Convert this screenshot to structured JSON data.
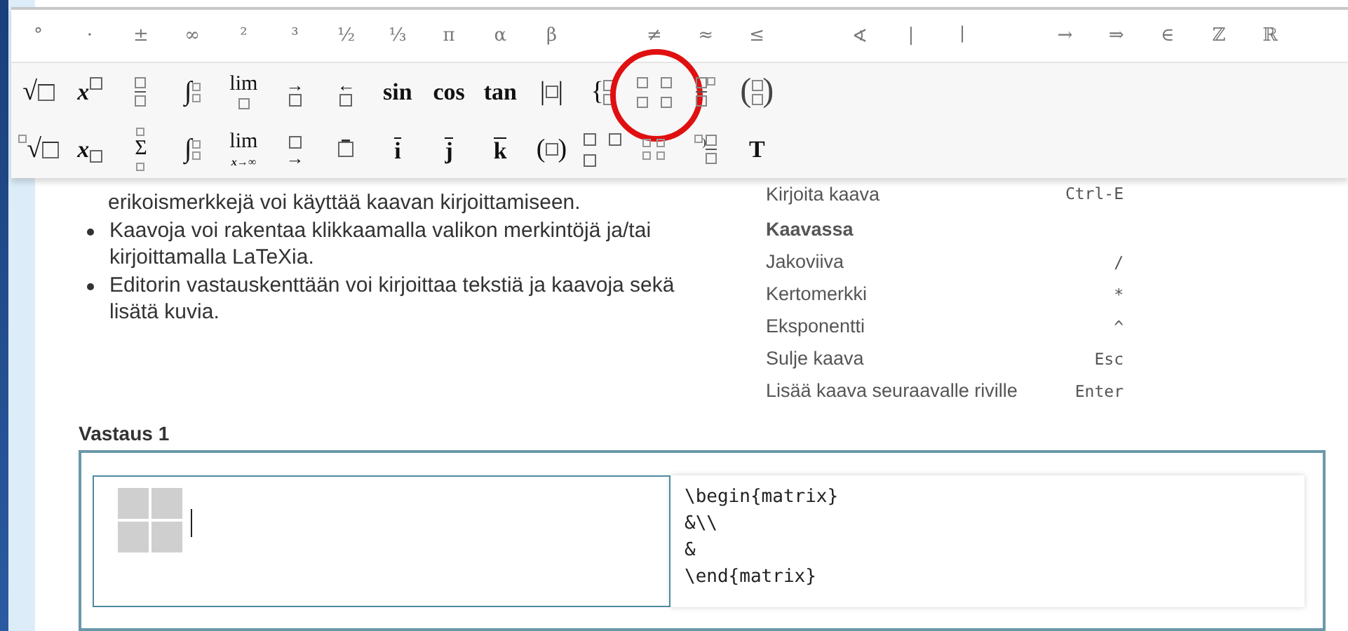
{
  "toolbar": {
    "symbols": [
      {
        "symbol": "°"
      },
      {
        "symbol": "·"
      },
      {
        "symbol": "±"
      },
      {
        "symbol": "∞"
      },
      {
        "symbol": "²"
      },
      {
        "symbol": "³"
      },
      {
        "symbol": "½"
      },
      {
        "symbol": "⅓"
      },
      {
        "symbol": "π"
      },
      {
        "symbol": "α"
      },
      {
        "symbol": "β"
      },
      {
        "symbol": "≠",
        "gap_before": true
      },
      {
        "symbol": "≈"
      },
      {
        "symbol": "≤"
      },
      {
        "symbol": "∢",
        "gap_before": true
      },
      {
        "symbol": "|"
      },
      {
        "symbol": "∣"
      },
      {
        "symbol": "→",
        "gap_before": true
      },
      {
        "symbol": "⇒"
      },
      {
        "symbol": "∈"
      },
      {
        "symbol": "ℤ"
      },
      {
        "symbol": "ℝ"
      }
    ],
    "template_rows": [
      [
        {
          "kind": "prefix-box",
          "text": "√"
        },
        {
          "kind": "sup-box",
          "text": "x"
        },
        {
          "kind": "fraction"
        },
        {
          "kind": "integral",
          "text": "∫"
        },
        {
          "kind": "under-box",
          "text": "lim"
        },
        {
          "kind": "over-glyph",
          "text": "→"
        },
        {
          "kind": "over-glyph",
          "text": "←"
        },
        {
          "kind": "word",
          "text": "sin"
        },
        {
          "kind": "word",
          "text": "cos"
        },
        {
          "kind": "word",
          "text": "tan"
        },
        {
          "kind": "wrap",
          "open": "|",
          "close": "|"
        },
        {
          "kind": "cases",
          "text": "{"
        },
        {
          "kind": "matrix",
          "circled": true
        },
        {
          "kind": "frac-sup"
        },
        {
          "kind": "binom",
          "open": "(",
          "close": ")"
        }
      ],
      [
        {
          "kind": "nth-root",
          "text": "√"
        },
        {
          "kind": "sub-box",
          "text": "x"
        },
        {
          "kind": "big-op",
          "text": "Σ"
        },
        {
          "kind": "integral",
          "text": "∫"
        },
        {
          "kind": "under-text",
          "text": "lim",
          "sub": "x→∞"
        },
        {
          "kind": "under-glyph",
          "text": "→"
        },
        {
          "kind": "bar-box"
        },
        {
          "kind": "bar-letter",
          "text": "i"
        },
        {
          "kind": "bar-letter",
          "text": "j"
        },
        {
          "kind": "bar-letter",
          "text": "k"
        },
        {
          "kind": "wrap",
          "open": "(",
          "close": ")"
        },
        {
          "kind": "box-grid"
        },
        {
          "kind": "small-matrix"
        },
        {
          "kind": "pre-frac",
          "text": ")"
        },
        {
          "kind": "word",
          "text": "T"
        }
      ]
    ]
  },
  "instructions": {
    "paragraph": "erikoismerkkejä voi käyttää kaavan kirjoittamiseen.",
    "bullets": [
      "Kaavoja voi rakentaa klikkaamalla valikon merkintöjä ja/tai kirjoittamalla LaTeXia.",
      "Editorin vastauskenttään voi kirjoittaa tekstiä ja kaavoja sekä lisätä kuvia."
    ]
  },
  "shortcuts": [
    {
      "kind": "shortcut",
      "label": "Kirjoita kaava",
      "key": "Ctrl-E"
    },
    {
      "kind": "heading",
      "label": "Kaavassa"
    },
    {
      "kind": "shortcut",
      "label": "Jakoviiva",
      "key": "/"
    },
    {
      "kind": "shortcut",
      "label": "Kertomerkki",
      "key": "*"
    },
    {
      "kind": "shortcut",
      "label": "Eksponentti",
      "key": "^"
    },
    {
      "kind": "shortcut",
      "label": "Sulje kaava",
      "key": "Esc"
    },
    {
      "kind": "shortcut",
      "label": "Lisää kaava seuraavalle riville",
      "key": "Enter"
    }
  ],
  "answer": {
    "title": "Vastaus 1",
    "latex_lines": [
      "\\begin{matrix}",
      "&\\\\",
      "&",
      "\\end{matrix}"
    ]
  }
}
